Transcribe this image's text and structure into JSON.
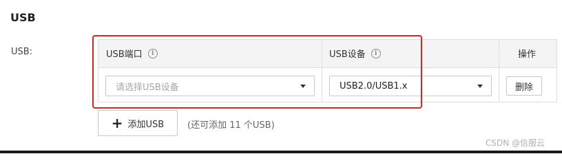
{
  "section": {
    "title": "USB"
  },
  "field": {
    "label": "USB:"
  },
  "table": {
    "headers": {
      "port": "USB端口",
      "device": "USB设备",
      "action": "操作"
    },
    "info_icon_glyph": "i",
    "row": {
      "port_placeholder": "请选择USB设备",
      "device_value": "USB2.0/USB1.x",
      "delete_label": "删除"
    }
  },
  "add": {
    "plus_glyph": "+",
    "label": "添加USB",
    "hint": "(还可添加 11 个USB)"
  },
  "watermark": "CSDN @信服云",
  "colors": {
    "highlight": "#d9241c",
    "header_bg": "#f4f4f4",
    "border": "#dcdcdc"
  },
  "icons": [
    "info-icon",
    "chevron-down-icon",
    "plus-icon"
  ]
}
